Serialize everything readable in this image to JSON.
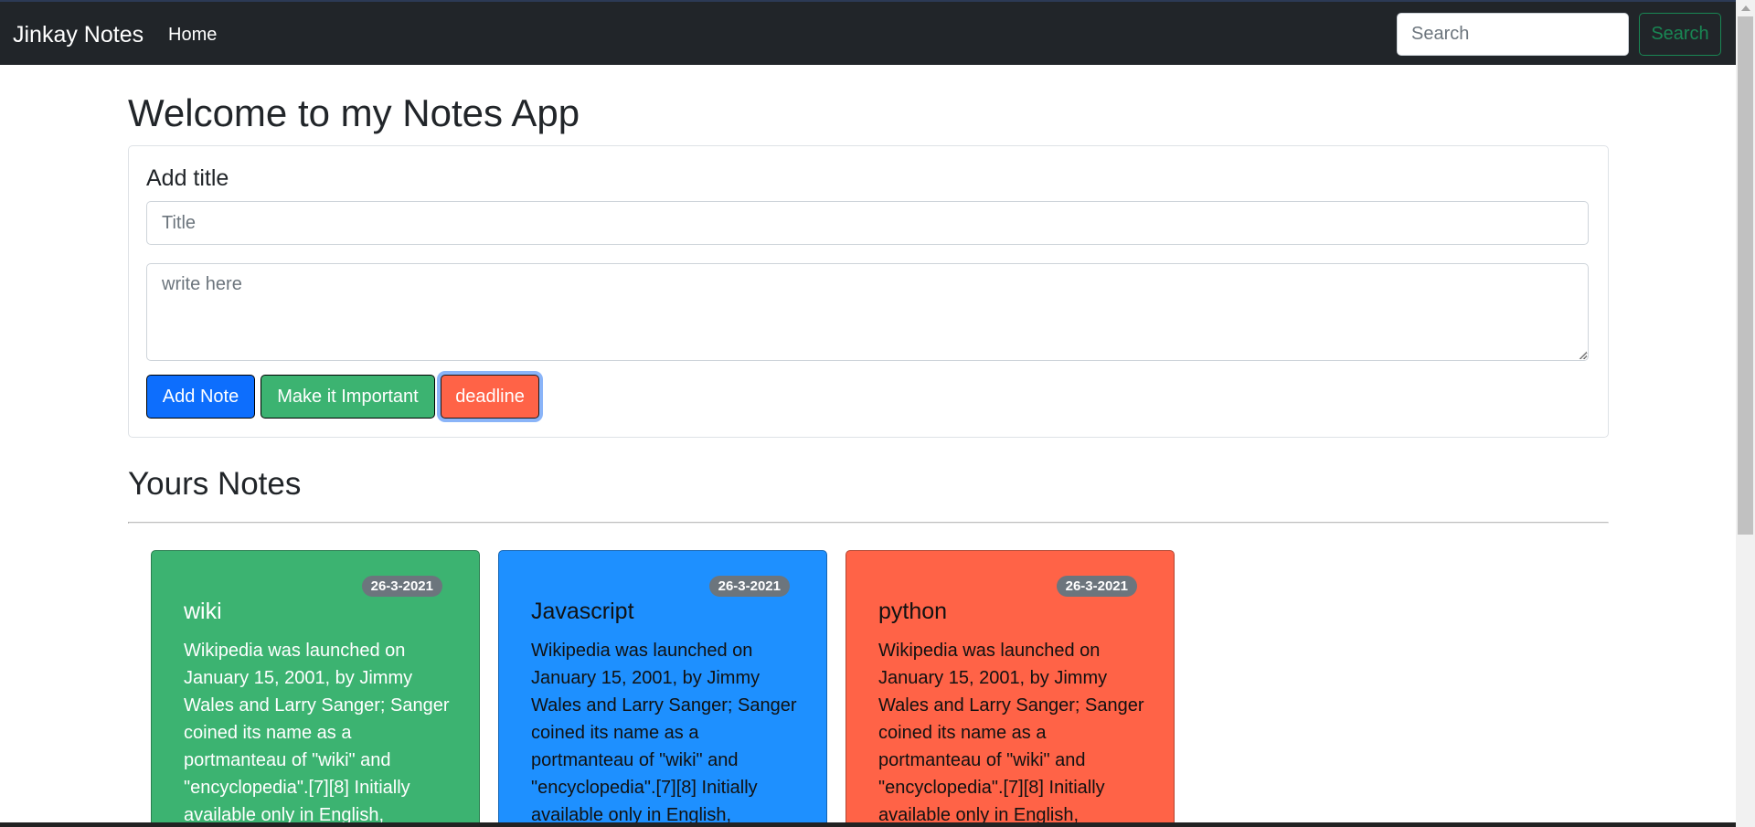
{
  "navbar": {
    "brand": "Jinkay Notes",
    "home_link": "Home",
    "search_placeholder": "Search",
    "search_button": "Search"
  },
  "main": {
    "title": "Welcome to my Notes App",
    "form": {
      "label": "Add title",
      "title_placeholder": "Title",
      "body_placeholder": "write here",
      "add_button": "Add Note",
      "important_button": "Make it Important",
      "deadline_button": "deadline"
    },
    "notes_heading": "Yours Notes",
    "notes": [
      {
        "date": "26-3-2021",
        "title": "wiki",
        "body": "Wikipedia was launched on January 15, 2001, by Jimmy Wales and Larry Sanger; Sanger coined its name as a portmanteau of \"wiki\" and \"encyclopedia\".[7][8] Initially available only in English,",
        "color": "#3cb371"
      },
      {
        "date": "26-3-2021",
        "title": "Javascript",
        "body": "Wikipedia was launched on January 15, 2001, by Jimmy Wales and Larry Sanger; Sanger coined its name as a portmanteau of \"wiki\" and \"encyclopedia\".[7][8] Initially available only in English,",
        "color": "#1e90ff"
      },
      {
        "date": "26-3-2021",
        "title": "python",
        "body": "Wikipedia was launched on January 15, 2001, by Jimmy Wales and Larry Sanger; Sanger coined its name as a portmanteau of \"wiki\" and \"encyclopedia\".[7][8] Initially available only in English,",
        "color": "#ff6347"
      }
    ]
  },
  "colors": {
    "navbar_bg": "#212529",
    "primary": "#0d6efd",
    "success": "#198754",
    "important": "#3cb371",
    "deadline": "#ff6347",
    "badge": "#6c757d"
  }
}
